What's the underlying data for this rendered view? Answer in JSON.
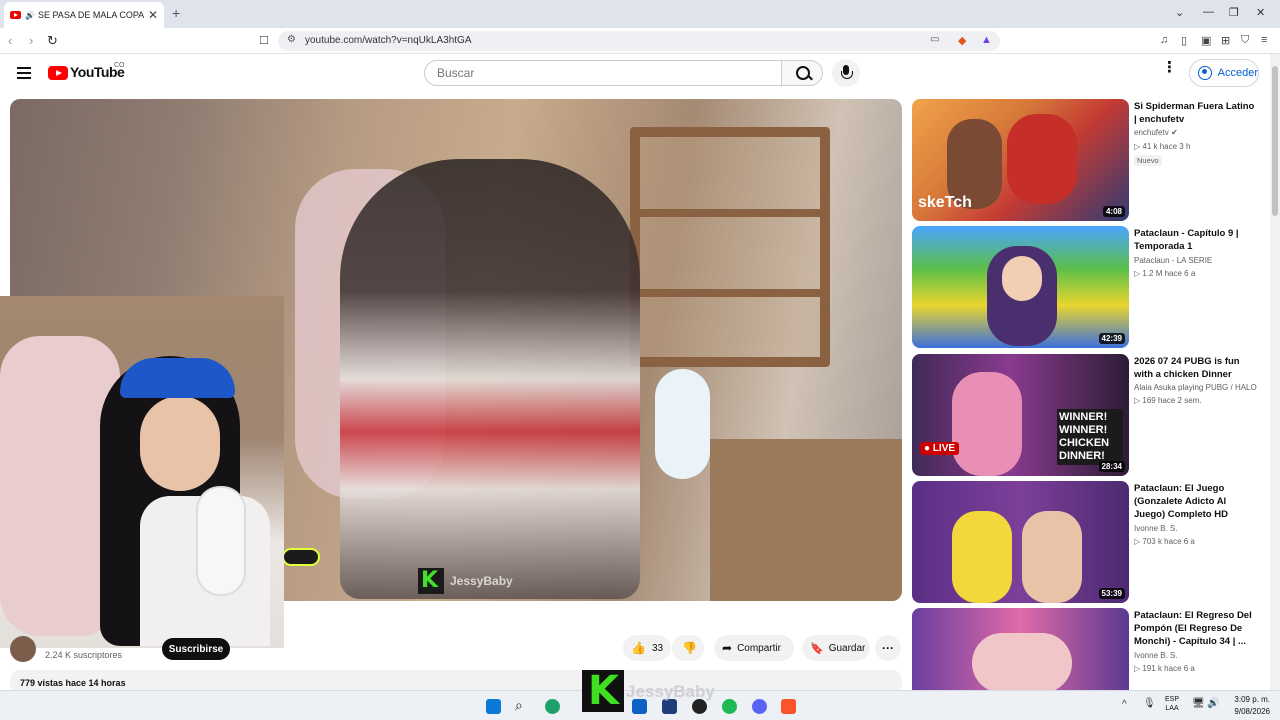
{
  "browser": {
    "tab_title": "SE PASA DE MALA COPA Y LL...",
    "url": "youtube.com/watch?v=nqUkLA3htGA"
  },
  "masthead": {
    "wordmark": "YouTube",
    "country": "CO",
    "search_placeholder": "Buscar",
    "signin_label": "Acceder"
  },
  "video": {
    "watermark": "JessyBaby",
    "subscribers": "2.24 K suscriptores",
    "subscribe_label": "Suscribirse",
    "likes": "33",
    "share_label": "Compartir",
    "save_label": "Guardar",
    "views_line": "779 vistas  hace 14 horas"
  },
  "recommendations": [
    {
      "title": "Si Spiderman Fuera Latino | enchufetv",
      "channel": "enchufetv",
      "meta": "▷ 41 k   hace 3 h",
      "badge": "Nuevo",
      "duration": "4:08"
    },
    {
      "title": "Pataclaun - Capítulo 9 | Temporada 1",
      "channel": "Pataclaun - LA SERIE",
      "meta": "▷ 1.2 M   hace 6 a",
      "badge": "",
      "duration": "42:39"
    },
    {
      "title": "2026 07 24  PUBG  is  fun with a chicken Dinner",
      "channel": "Alaia Asuka playing PUBG / HALO",
      "meta": "▷ 169   hace 2 sem.",
      "badge": "",
      "duration": "28:34"
    },
    {
      "title": "Pataclaun: El Juego (Gonzalete Adicto Al Juego) Completo HD",
      "channel": "Ivonne B. S.",
      "meta": "▷ 703 k   hace 6 a",
      "badge": "",
      "duration": "53:39"
    },
    {
      "title": "Pataclaun: El Regreso Del Pompón (El Regreso De Monchi) - Capítulo 34 | ...",
      "channel": "Ivonne B. S.",
      "meta": "▷ 191 k   hace 6 a",
      "badge": "",
      "duration": ""
    }
  ],
  "thumb_texts": {
    "sketch": "skeTch",
    "live": "● LIVE",
    "winner": "WINNER! WINNER! CHICKEN DINNER!"
  },
  "taskbar": {
    "lang_top": "ESP",
    "lang_bottom": "LAA",
    "time": "3:09 p. m.",
    "date": "9/08/2026",
    "overlay_text": "JessyBaby"
  }
}
